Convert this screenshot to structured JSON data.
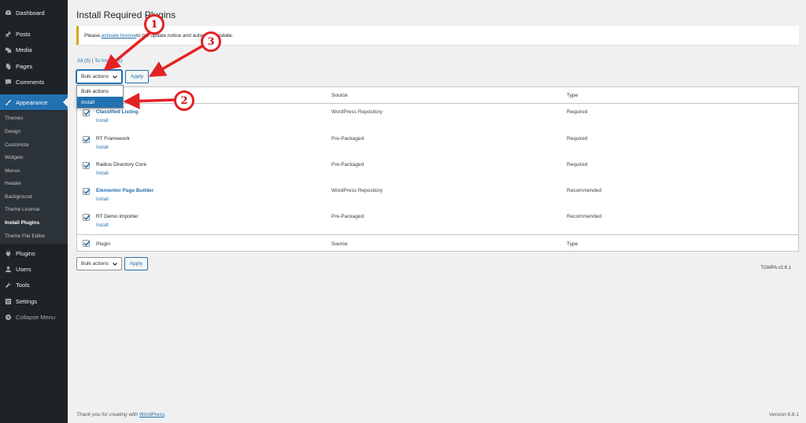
{
  "sidebar": {
    "items": [
      {
        "label": "Dashboard",
        "icon": "dashboard-icon"
      },
      {
        "label": "Posts",
        "icon": "pin-icon"
      },
      {
        "label": "Media",
        "icon": "media-icon"
      },
      {
        "label": "Pages",
        "icon": "pages-icon"
      },
      {
        "label": "Comments",
        "icon": "comment-icon"
      },
      {
        "label": "Appearance",
        "icon": "brush-icon"
      }
    ],
    "submenu": [
      "Themes",
      "Design",
      "Customize",
      "Widgets",
      "Menus",
      "Header",
      "Background",
      "Theme License",
      "Install Plugins",
      "Theme File Editor"
    ],
    "items_bottom": [
      {
        "label": "Plugins",
        "icon": "plugin-icon"
      },
      {
        "label": "Users",
        "icon": "users-icon"
      },
      {
        "label": "Tools",
        "icon": "wrench-icon"
      },
      {
        "label": "Settings",
        "icon": "settings-icon"
      },
      {
        "label": "Collapse Menu",
        "icon": "collapse-icon"
      }
    ],
    "accent": "#2271b1"
  },
  "page": {
    "title": "Install Required Plugins",
    "notice": {
      "prefix": "Please, ",
      "link": "activate license",
      "suffix": " to get update notice and automatic update."
    },
    "filters": {
      "all": "All (5)",
      "sep": " | ",
      "to_install": "To Install (5)"
    }
  },
  "bulk": {
    "select_label": "Bulk actions",
    "apply": "Apply",
    "options": [
      "Bulk actions",
      "Install"
    ],
    "selected_option": "Install"
  },
  "table": {
    "columns": [
      "Plugin",
      "Source",
      "Type"
    ],
    "rows": [
      {
        "name": "Classified Listing",
        "action": "Install",
        "source": "WordPress Repository",
        "type": "Required"
      },
      {
        "name": "RT Framework",
        "action": "Install",
        "source": "Pre-Packaged",
        "type": "Required"
      },
      {
        "name": "Radius Directory Core",
        "action": "Install",
        "source": "Pre-Packaged",
        "type": "Required"
      },
      {
        "name": "Elementor Page Builder",
        "action": "Install",
        "source": "WordPress Repository",
        "type": "Recommended"
      },
      {
        "name": "RT Demo Importer",
        "action": "Install",
        "source": "Pre-Packaged",
        "type": "Recommended"
      }
    ]
  },
  "tgmpa_version": "TGMPA v2.6.1",
  "footer": {
    "thanks_prefix": "Thank you for creating with ",
    "thanks_link": "WordPress",
    "thanks_suffix": ".",
    "version": "Version 6.8.1"
  },
  "callouts": [
    "1",
    "2",
    "3"
  ],
  "colors": {
    "callout": "#e32222",
    "link": "#2271b1",
    "notice_border": "#dba617"
  }
}
